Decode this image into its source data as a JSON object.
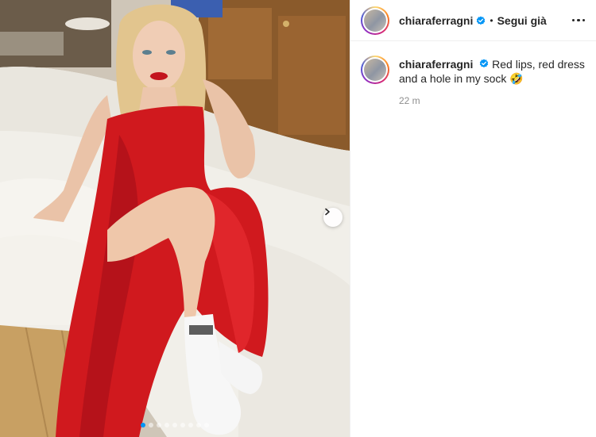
{
  "post": {
    "username": "chiaraferragni",
    "follow_label": "Segui già",
    "separator": "•",
    "caption": "Red lips, red dress and a hole in my sock 🤣",
    "time_ago": "22 m"
  },
  "carousel": {
    "total_slides": 9,
    "active_slide": 1
  },
  "icons": {
    "verified": "verified-badge-icon",
    "next": "chevron-right-icon",
    "more": "more-options-icon"
  },
  "colors": {
    "verified_blue": "#0095f6",
    "dress_red": "#d0191e"
  }
}
